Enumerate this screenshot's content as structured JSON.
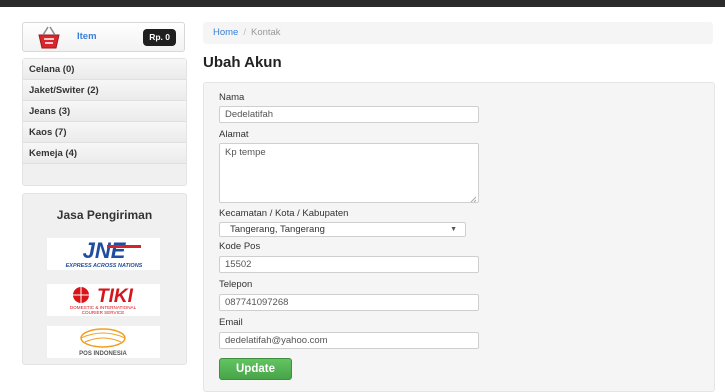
{
  "cart": {
    "label": "Item",
    "total": "Rp. 0",
    "icon": "shopping-basket-icon"
  },
  "categories": [
    {
      "label": "Celana (0)"
    },
    {
      "label": "Jaket/Switer (2)"
    },
    {
      "label": "Jeans (3)"
    },
    {
      "label": "Kaos (7)"
    },
    {
      "label": "Kemeja (4)"
    }
  ],
  "shipping": {
    "title": "Jasa Pengiriman",
    "logos": [
      {
        "name": "JNE",
        "tagline": "EXPRESS ACROSS NATIONS"
      },
      {
        "name": "TIKI",
        "tagline": "DOMESTIC & INTERNATIONAL COURIER SERVICE"
      },
      {
        "name": "POS INDONESIA"
      }
    ]
  },
  "breadcrumb": {
    "home": "Home",
    "separator": "/",
    "current": "Kontak"
  },
  "page": {
    "title": "Ubah Akun"
  },
  "form": {
    "nama_label": "Nama",
    "nama_value": "Dedelatifah",
    "alamat_label": "Alamat",
    "alamat_value": "Kp tempe",
    "kecamatan_label": "Kecamatan / Kota / Kabupaten",
    "kecamatan_value": "Tangerang, Tangerang",
    "kodepos_label": "Kode Pos",
    "kodepos_value": "15502",
    "telepon_label": "Telepon",
    "telepon_value": "087741097268",
    "email_label": "Email",
    "email_value": "dedelatifah@yahoo.com",
    "submit_label": "Update"
  },
  "colors": {
    "link": "#3a7fd5",
    "button": "#5bb75b",
    "jne_blue": "#1f4ea1",
    "jne_red": "#d4242a",
    "tiki_red": "#d7141a"
  }
}
